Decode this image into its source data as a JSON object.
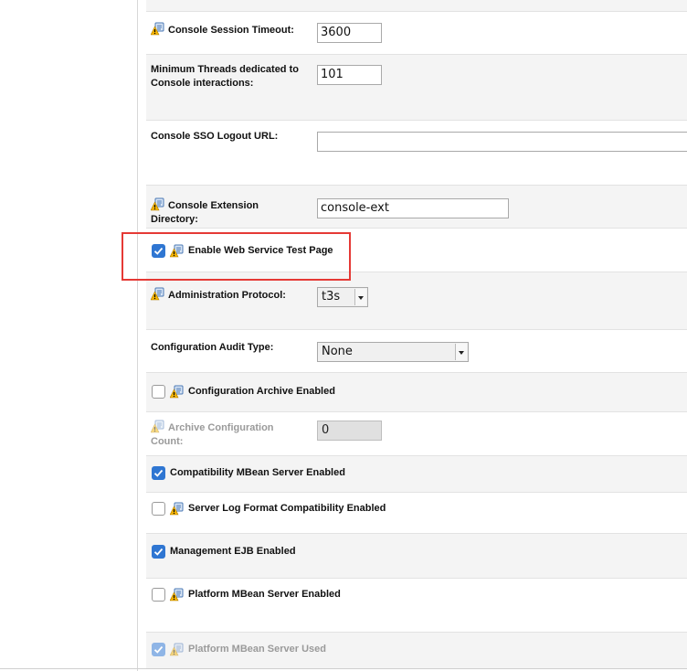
{
  "settings": {
    "console_session_timeout": {
      "label": "Console Session Timeout:",
      "value": "3600"
    },
    "min_threads": {
      "label": "Minimum Threads dedicated to Console interactions:",
      "value": "101"
    },
    "console_sso_logout_url": {
      "label": "Console SSO Logout URL:",
      "value": ""
    },
    "console_extension_directory": {
      "label": "Console Extension Directory:",
      "value": "console-ext"
    },
    "enable_web_service_test_page": {
      "label": "Enable Web Service Test Page",
      "checked": true
    },
    "administration_protocol": {
      "label": "Administration Protocol:",
      "value": "t3s"
    },
    "configuration_audit_type": {
      "label": "Configuration Audit Type:",
      "value": "None"
    },
    "configuration_archive_enabled": {
      "label": "Configuration Archive Enabled",
      "checked": false
    },
    "archive_configuration_count": {
      "label": "Archive Configuration Count:",
      "value": "0",
      "disabled": true
    },
    "compatibility_mbean_server_enabled": {
      "label": "Compatibility MBean Server Enabled",
      "checked": true
    },
    "server_log_format_compatibility_enabled": {
      "label": "Server Log Format Compatibility Enabled",
      "checked": false
    },
    "management_ejb_enabled": {
      "label": "Management EJB Enabled",
      "checked": true
    },
    "platform_mbean_server_enabled": {
      "label": "Platform MBean Server Enabled",
      "checked": false
    },
    "platform_mbean_server_used": {
      "label": "Platform MBean Server Used",
      "checked": true,
      "disabled": true
    }
  },
  "colors": {
    "checkbox_checked": "#2f76d2",
    "highlight_border": "#e53935",
    "row_shade": "#f4f4f4"
  },
  "icons": {
    "restart_required": "warning-info-icon"
  }
}
